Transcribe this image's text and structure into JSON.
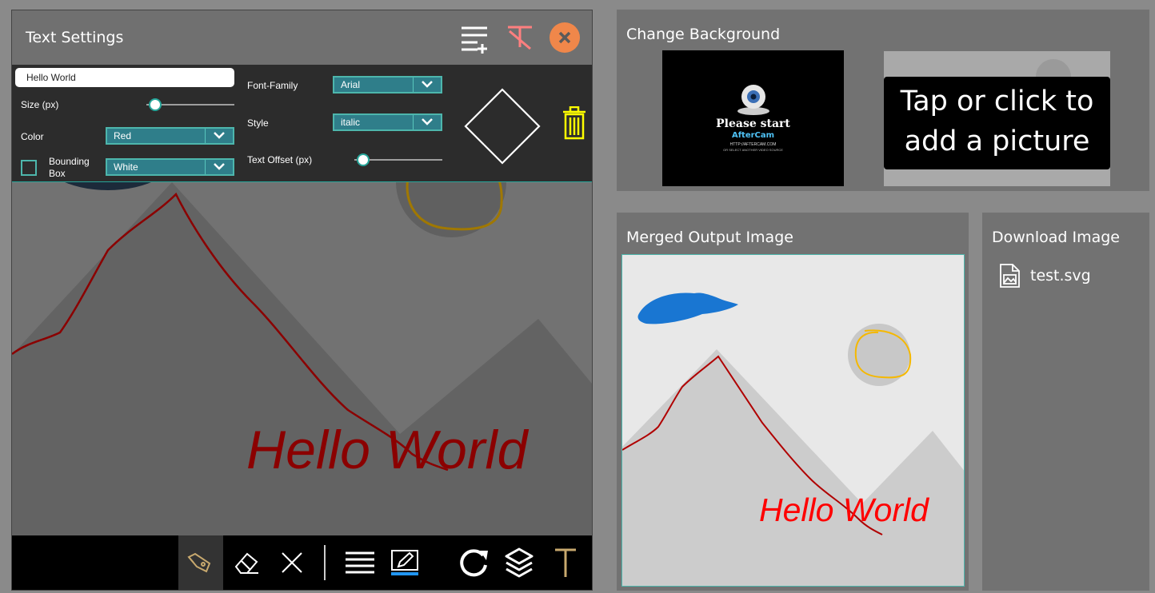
{
  "text_settings": {
    "title": "Text Settings",
    "text_value": "Hello World",
    "size_label": "Size (px)",
    "size_level": 0.1,
    "color_label": "Color",
    "color_value": "Red",
    "bounding_box_label": "Bounding Box",
    "bounding_box_checked": false,
    "bounding_box_color": "White",
    "font_family_label": "Font-Family",
    "font_family_value": "Arial",
    "style_label": "Style",
    "style_value": "italic",
    "text_offset_label": "Text Offset (px)",
    "text_offset_level": 0.1
  },
  "canvas": {
    "text": "Hello World",
    "text_color": "#8b0000",
    "background_color": "#727272"
  },
  "toolbar": {
    "tools": [
      "pen-icon",
      "eraser-icon",
      "clear-icon",
      "line-width-icon",
      "pen-color-icon",
      "redo-icon",
      "layers-icon",
      "text-icon"
    ],
    "active_tool": "pen-icon"
  },
  "change_background": {
    "title": "Change Background",
    "thumb1_line1": "Please start",
    "thumb1_line2": "AfterCam",
    "thumb1_line3": "HTTP://AFTERCAM.COM",
    "thumb1_line4": "OR SELECT ANOTHER VIDEO SOURCE",
    "add_picture_line1": "Tap or click to",
    "add_picture_line2": "add a picture"
  },
  "merged_output": {
    "title": "Merged Output Image",
    "text": "Hello World",
    "text_color": "#ff0000"
  },
  "download": {
    "title": "Download Image",
    "file_name": "test.svg"
  },
  "colors": {
    "accent": "#26a69a",
    "close_button": "#f0874a",
    "delete_icon": "#ffff00",
    "clear_format_icon": "#ff7f7f"
  }
}
